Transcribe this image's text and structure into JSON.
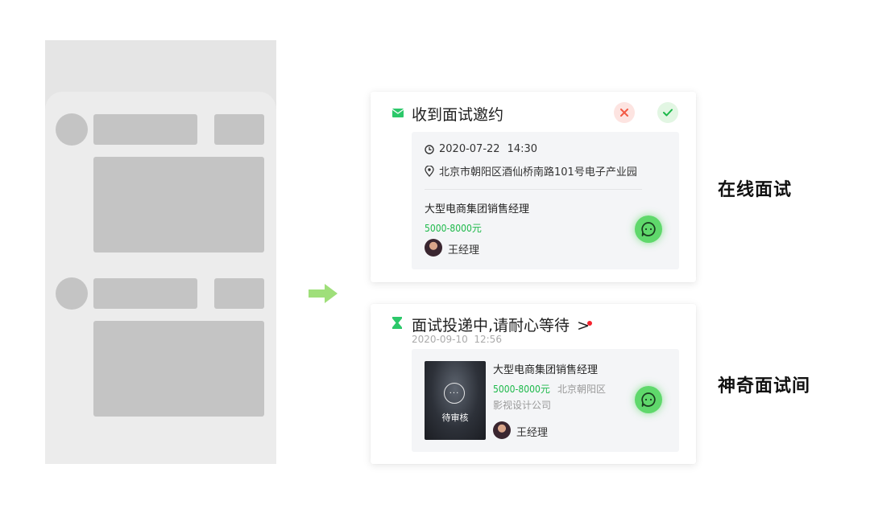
{
  "colors": {
    "accent_green": "#1db94a",
    "chat_green": "#5fd86b",
    "arrow_green": "#9fdf7a",
    "reject_red": "#f25a45",
    "badge_red": "#f5222d"
  },
  "card_online": {
    "title": "收到面试邀约",
    "title_icon": "envelope-icon",
    "date": "2020-07-22",
    "time": "14:30",
    "address": "北京市朝阳区酒仙桥南路101号电子产业园",
    "job_title": "大型电商集团销售经理",
    "salary": "5000-8000元",
    "hr_name": "王经理"
  },
  "card_room": {
    "title": "面试投递中,请耐心等待",
    "title_icon": "hourglass-icon",
    "chevron": ">",
    "timestamp": "2020-09-10  12:56",
    "thumb_label": "待审核",
    "job_title": "大型电商集团销售经理",
    "salary": "5000-8000元",
    "location": "北京朝阳区",
    "company": "影视设计公司",
    "hr_name": "王经理"
  },
  "labels": {
    "online_interview": "在线面试",
    "magic_interview_room": "神奇面试间"
  }
}
